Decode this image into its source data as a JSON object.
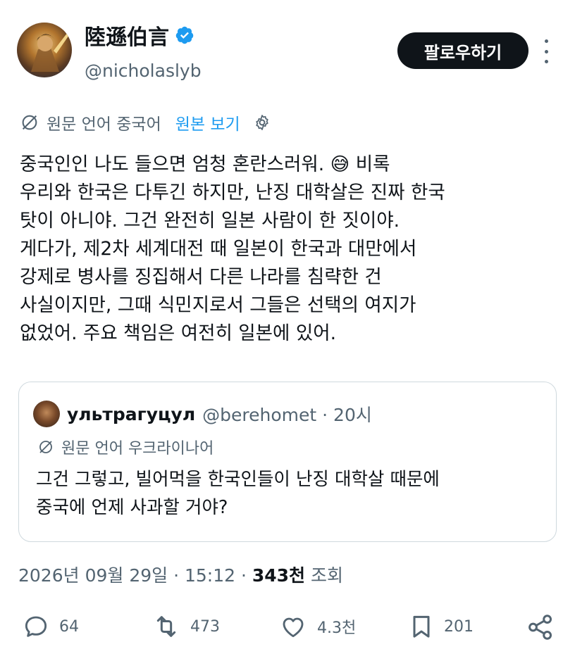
{
  "author": {
    "display_name": "陸遜伯言",
    "handle": "@nicholaslyb",
    "verified_icon": "verified-badge-icon",
    "badge_color": "#1d9bf0"
  },
  "follow_button": {
    "label": "팔로우하기"
  },
  "translation": {
    "label": "원문 언어 중국어",
    "show_original": "원본 보기"
  },
  "post": {
    "line1a": "중국인인 나도 들으면 엄청 혼란스러워. ",
    "emoji": "😅",
    "line1b": " 비록",
    "rest": "우리와 한국은 다투긴 하지만, 난징 대학살은 진짜 한국\n탓이 아니야. 그건 완전히 일본 사람이 한 짓이야.\n게다가, 제2차 세계대전 때 일본이 한국과 대만에서\n강제로 병사를 징집해서 다른 나라를 침략한 건\n사실이지만, 그때 식민지로서 그들은 선택의 여지가\n없었어. 주요 책임은 여전히 일본에 있어."
  },
  "quote": {
    "display_name": "ультрагуцул",
    "meta": "@berehomet · 20시",
    "translation": "원문 언어 우크라이나어",
    "text": "그건 그렇고, 빌어먹을 한국인들이 난징 대학살 때문에\n중국에 언제 사과할 거야?"
  },
  "timestamp": {
    "datetime": "2026년 09월 29일 · 15:12",
    "sep": " · ",
    "views_count": "343천",
    "views_label": " 조회"
  },
  "actions": {
    "replies": "64",
    "reposts": "473",
    "likes": "4.3천",
    "bookmarks": "201"
  },
  "colors": {
    "text": "#0f1419",
    "secondary": "#536471",
    "link": "#1d9bf0",
    "border": "#cfd9de"
  }
}
